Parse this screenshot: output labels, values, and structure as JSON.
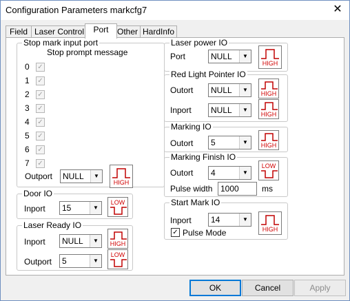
{
  "window": {
    "title": "Configuration Parameters markcfg7",
    "close_glyph": "✕"
  },
  "tabs": [
    {
      "label": "Field"
    },
    {
      "label": "Laser Control"
    },
    {
      "label": "Port"
    },
    {
      "label": "Other"
    },
    {
      "label": "HardInfo"
    }
  ],
  "active_tab": "Port",
  "stop_mark": {
    "title": "Stop mark input port",
    "prompt_header": "Stop prompt message",
    "ports": [
      {
        "label": "0",
        "checked": true
      },
      {
        "label": "1",
        "checked": true
      },
      {
        "label": "2",
        "checked": true
      },
      {
        "label": "3",
        "checked": true
      },
      {
        "label": "4",
        "checked": true
      },
      {
        "label": "5",
        "checked": true
      },
      {
        "label": "6",
        "checked": true
      },
      {
        "label": "7",
        "checked": true
      }
    ],
    "outport_label": "Outport",
    "outport_value": "NULL",
    "signal": "HIGH"
  },
  "door_io": {
    "title": "Door IO",
    "inport_label": "Inport",
    "inport_value": "15",
    "signal": "LOW"
  },
  "laser_ready_io": {
    "title": "Laser Ready IO",
    "inport_label": "Inport",
    "inport_value": "NULL",
    "inport_signal": "HIGH",
    "outport_label": "Outport",
    "outport_value": "5",
    "outport_signal": "LOW"
  },
  "laser_power_io": {
    "title": "Laser power IO",
    "port_label": "Port",
    "port_value": "NULL",
    "signal": "HIGH"
  },
  "red_light_io": {
    "title": "Red Light Pointer IO",
    "outport_label": "Outort",
    "outport_value": "NULL",
    "outport_signal": "HIGH",
    "inport_label": "Inport",
    "inport_value": "NULL",
    "inport_signal": "HIGH"
  },
  "marking_io": {
    "title": "Marking IO",
    "outport_label": "Outort",
    "outport_value": "5",
    "signal": "HIGH"
  },
  "marking_finish_io": {
    "title": "Marking Finish IO",
    "outport_label": "Outort",
    "outport_value": "4",
    "signal": "LOW",
    "pulse_label": "Pulse width",
    "pulse_value": "1000",
    "pulse_unit": "ms"
  },
  "start_mark_io": {
    "title": "Start Mark IO",
    "inport_label": "Inport",
    "inport_value": "14",
    "signal": "HIGH",
    "pulse_mode_label": "Pulse Mode",
    "pulse_mode_checked": true
  },
  "buttons": {
    "ok": "OK",
    "cancel": "Cancel",
    "apply": "Apply"
  },
  "glyphs": {
    "check": "✓",
    "dropdown": "▼"
  },
  "colors": {
    "signal_text": "#d00000",
    "default_button_border": "#0078d7"
  }
}
